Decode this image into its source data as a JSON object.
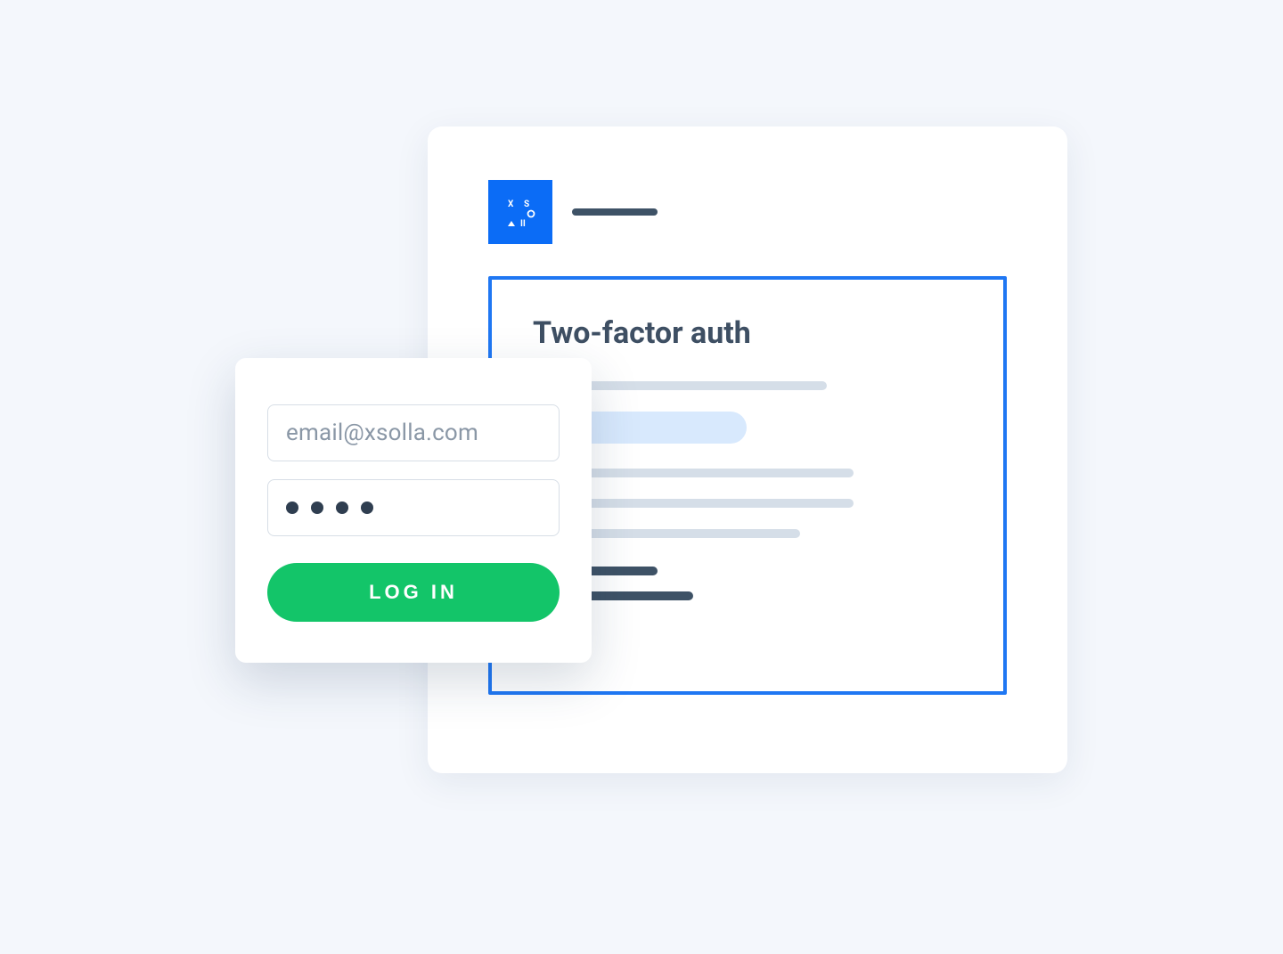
{
  "back_card": {
    "auth_panel_title": "Two-factor auth"
  },
  "login_card": {
    "email_placeholder": "email@xsolla.com",
    "login_button_label": "LOG IN"
  },
  "colors": {
    "brand_blue": "#0b6cf6",
    "action_green": "#13c569",
    "slate_dark": "#3e5266"
  }
}
